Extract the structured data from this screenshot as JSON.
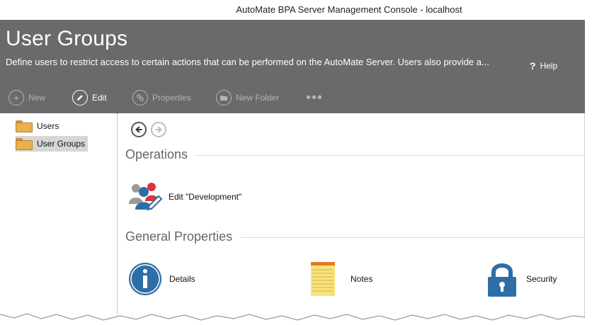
{
  "window": {
    "title": "AutoMate BPA Server Management Console - localhost"
  },
  "header": {
    "title": "User Groups",
    "description": "Define users to restrict access to certain actions that can be performed on the AutoMate Server.  Users also provide a...",
    "help_label": "Help",
    "help_icon": "question-mark-icon"
  },
  "toolbar": {
    "new_label": "New",
    "edit_label": "Edit",
    "properties_label": "Properties",
    "new_folder_label": "New Folder",
    "more_label": "•••"
  },
  "tree": {
    "items": [
      {
        "label": "Users",
        "selected": false
      },
      {
        "label": "User Groups",
        "selected": true
      }
    ]
  },
  "main": {
    "operations_title": "Operations",
    "operations": [
      {
        "label": "Edit \"Development\"",
        "icon": "edit-users-icon"
      }
    ],
    "general_title": "General Properties",
    "properties": [
      {
        "label": "Details",
        "icon": "info-icon"
      },
      {
        "label": "Notes",
        "icon": "notepad-icon"
      },
      {
        "label": "Security",
        "icon": "padlock-icon"
      }
    ]
  },
  "colors": {
    "header_bg": "#6a6a6a",
    "accent_blue": "#2e6ea6",
    "folder": "#e8b04f"
  }
}
